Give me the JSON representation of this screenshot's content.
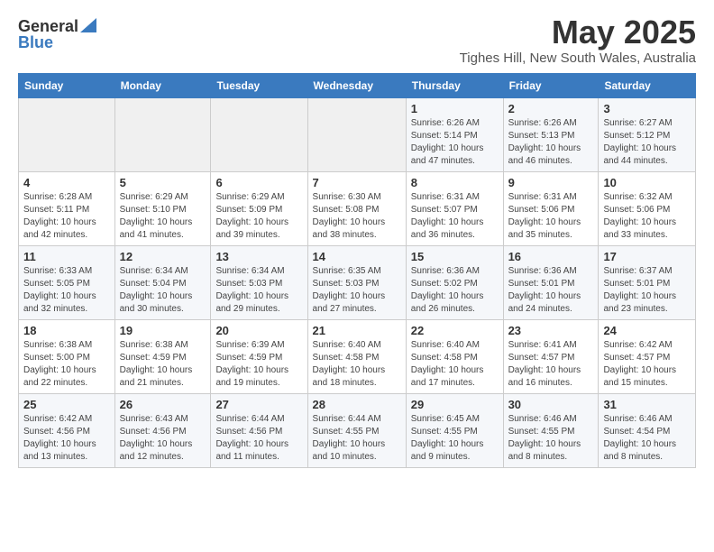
{
  "header": {
    "logo_general": "General",
    "logo_blue": "Blue",
    "month": "May 2025",
    "location": "Tighes Hill, New South Wales, Australia"
  },
  "weekdays": [
    "Sunday",
    "Monday",
    "Tuesday",
    "Wednesday",
    "Thursday",
    "Friday",
    "Saturday"
  ],
  "weeks": [
    [
      {
        "day": "",
        "info": ""
      },
      {
        "day": "",
        "info": ""
      },
      {
        "day": "",
        "info": ""
      },
      {
        "day": "",
        "info": ""
      },
      {
        "day": "1",
        "info": "Sunrise: 6:26 AM\nSunset: 5:14 PM\nDaylight: 10 hours\nand 47 minutes."
      },
      {
        "day": "2",
        "info": "Sunrise: 6:26 AM\nSunset: 5:13 PM\nDaylight: 10 hours\nand 46 minutes."
      },
      {
        "day": "3",
        "info": "Sunrise: 6:27 AM\nSunset: 5:12 PM\nDaylight: 10 hours\nand 44 minutes."
      }
    ],
    [
      {
        "day": "4",
        "info": "Sunrise: 6:28 AM\nSunset: 5:11 PM\nDaylight: 10 hours\nand 42 minutes."
      },
      {
        "day": "5",
        "info": "Sunrise: 6:29 AM\nSunset: 5:10 PM\nDaylight: 10 hours\nand 41 minutes."
      },
      {
        "day": "6",
        "info": "Sunrise: 6:29 AM\nSunset: 5:09 PM\nDaylight: 10 hours\nand 39 minutes."
      },
      {
        "day": "7",
        "info": "Sunrise: 6:30 AM\nSunset: 5:08 PM\nDaylight: 10 hours\nand 38 minutes."
      },
      {
        "day": "8",
        "info": "Sunrise: 6:31 AM\nSunset: 5:07 PM\nDaylight: 10 hours\nand 36 minutes."
      },
      {
        "day": "9",
        "info": "Sunrise: 6:31 AM\nSunset: 5:06 PM\nDaylight: 10 hours\nand 35 minutes."
      },
      {
        "day": "10",
        "info": "Sunrise: 6:32 AM\nSunset: 5:06 PM\nDaylight: 10 hours\nand 33 minutes."
      }
    ],
    [
      {
        "day": "11",
        "info": "Sunrise: 6:33 AM\nSunset: 5:05 PM\nDaylight: 10 hours\nand 32 minutes."
      },
      {
        "day": "12",
        "info": "Sunrise: 6:34 AM\nSunset: 5:04 PM\nDaylight: 10 hours\nand 30 minutes."
      },
      {
        "day": "13",
        "info": "Sunrise: 6:34 AM\nSunset: 5:03 PM\nDaylight: 10 hours\nand 29 minutes."
      },
      {
        "day": "14",
        "info": "Sunrise: 6:35 AM\nSunset: 5:03 PM\nDaylight: 10 hours\nand 27 minutes."
      },
      {
        "day": "15",
        "info": "Sunrise: 6:36 AM\nSunset: 5:02 PM\nDaylight: 10 hours\nand 26 minutes."
      },
      {
        "day": "16",
        "info": "Sunrise: 6:36 AM\nSunset: 5:01 PM\nDaylight: 10 hours\nand 24 minutes."
      },
      {
        "day": "17",
        "info": "Sunrise: 6:37 AM\nSunset: 5:01 PM\nDaylight: 10 hours\nand 23 minutes."
      }
    ],
    [
      {
        "day": "18",
        "info": "Sunrise: 6:38 AM\nSunset: 5:00 PM\nDaylight: 10 hours\nand 22 minutes."
      },
      {
        "day": "19",
        "info": "Sunrise: 6:38 AM\nSunset: 4:59 PM\nDaylight: 10 hours\nand 21 minutes."
      },
      {
        "day": "20",
        "info": "Sunrise: 6:39 AM\nSunset: 4:59 PM\nDaylight: 10 hours\nand 19 minutes."
      },
      {
        "day": "21",
        "info": "Sunrise: 6:40 AM\nSunset: 4:58 PM\nDaylight: 10 hours\nand 18 minutes."
      },
      {
        "day": "22",
        "info": "Sunrise: 6:40 AM\nSunset: 4:58 PM\nDaylight: 10 hours\nand 17 minutes."
      },
      {
        "day": "23",
        "info": "Sunrise: 6:41 AM\nSunset: 4:57 PM\nDaylight: 10 hours\nand 16 minutes."
      },
      {
        "day": "24",
        "info": "Sunrise: 6:42 AM\nSunset: 4:57 PM\nDaylight: 10 hours\nand 15 minutes."
      }
    ],
    [
      {
        "day": "25",
        "info": "Sunrise: 6:42 AM\nSunset: 4:56 PM\nDaylight: 10 hours\nand 13 minutes."
      },
      {
        "day": "26",
        "info": "Sunrise: 6:43 AM\nSunset: 4:56 PM\nDaylight: 10 hours\nand 12 minutes."
      },
      {
        "day": "27",
        "info": "Sunrise: 6:44 AM\nSunset: 4:56 PM\nDaylight: 10 hours\nand 11 minutes."
      },
      {
        "day": "28",
        "info": "Sunrise: 6:44 AM\nSunset: 4:55 PM\nDaylight: 10 hours\nand 10 minutes."
      },
      {
        "day": "29",
        "info": "Sunrise: 6:45 AM\nSunset: 4:55 PM\nDaylight: 10 hours\nand 9 minutes."
      },
      {
        "day": "30",
        "info": "Sunrise: 6:46 AM\nSunset: 4:55 PM\nDaylight: 10 hours\nand 8 minutes."
      },
      {
        "day": "31",
        "info": "Sunrise: 6:46 AM\nSunset: 4:54 PM\nDaylight: 10 hours\nand 8 minutes."
      }
    ]
  ]
}
